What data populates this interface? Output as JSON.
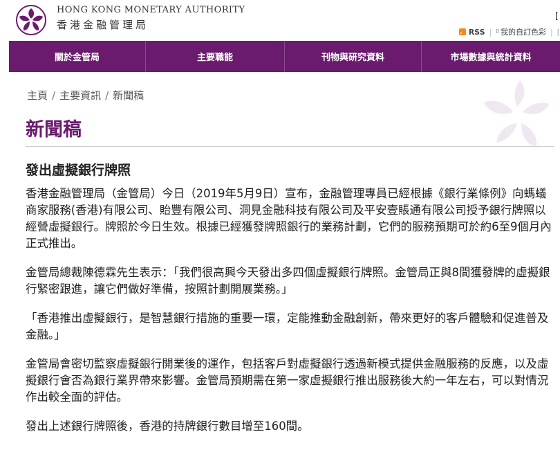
{
  "header": {
    "org_name_en": "HONG KONG MONETARY AUTHORITY",
    "org_name_zh": "香港金融管理局",
    "util_top_text": "[",
    "rss_label": "RSS",
    "custom_color_label": "我的自訂色彩",
    "trailing_text": "[",
    "brand_color": "#6a1b6e"
  },
  "nav": {
    "items": [
      {
        "label": "關於金管局"
      },
      {
        "label": "主要職能"
      },
      {
        "label": "刊物與研究資料"
      },
      {
        "label": "市場數據與統計資料"
      }
    ]
  },
  "breadcrumb": {
    "items": [
      "主頁",
      "主要資訊",
      "新聞稿"
    ],
    "separator": "/"
  },
  "page_title": "新聞稿",
  "article": {
    "title": "發出虛擬銀行牌照",
    "paragraphs": [
      "香港金融管理局（金管局）今日（2019年5月9日）宣布，金融管理專員已經根據《銀行業條例》向螞蟻商家服務(香港)有限公司、貽豐有限公司、洞見金融科技有限公司及平安壹賬通有限公司授予銀行牌照以經營虛擬銀行。牌照於今日生效。根據已經獲發牌照銀行的業務計劃，它們的服務預期可於約6至9個月內正式推出。",
      "金管局總裁陳德霖先生表示：「我們很高興今天發出多四個虛擬銀行牌照。金管局正與8間獲發牌的虛擬銀行緊密跟進，讓它們做好準備，按照計劃開展業務。」",
      "「香港推出虛擬銀行，是智慧銀行措施的重要一環，定能推動金融創新，帶來更好的客戶體驗和促進普及金融。」",
      "金管局會密切監察虛擬銀行開業後的運作，包括客戶對虛擬銀行透過新模式提供金融服務的反應，以及虛擬銀行會否為銀行業界帶來影響。金管局預期需在第一家虛擬銀行推出服務後大約一年左右，可以對情況作出較全面的評估。",
      "發出上述銀行牌照後，香港的持牌銀行數目增至160間。"
    ]
  }
}
